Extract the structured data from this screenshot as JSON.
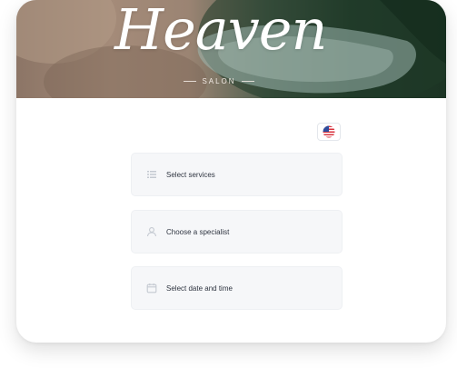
{
  "header": {
    "brand_title": "Heaven",
    "brand_subtitle": "SALON"
  },
  "language": {
    "flag_icon": "us-flag-icon"
  },
  "steps": [
    {
      "label": "Select services",
      "icon": "list-icon"
    },
    {
      "label": "Choose a specialist",
      "icon": "user-icon"
    },
    {
      "label": "Select date and time",
      "icon": "calendar-icon"
    }
  ],
  "colors": {
    "card_background": "#ffffff",
    "step_background": "#f6f7f9",
    "text": "#2f3541",
    "icon": "#c4c9d1"
  }
}
